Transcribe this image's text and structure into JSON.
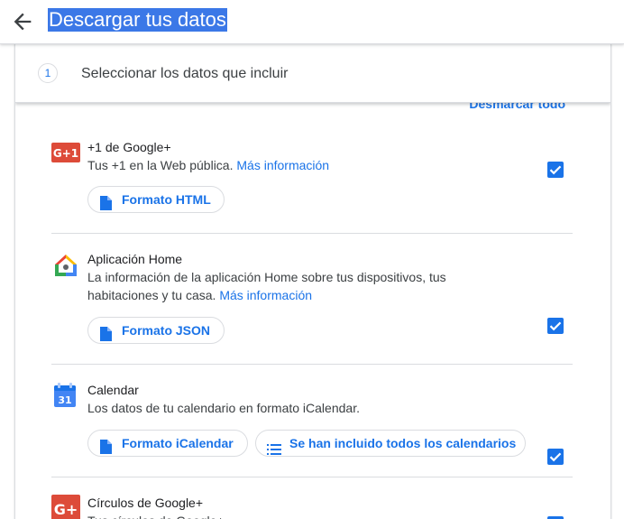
{
  "header": {
    "title": "Descargar tus datos"
  },
  "step": {
    "number": "1",
    "title": "Seleccionar los datos que incluir"
  },
  "deselect_all": "Desmarcar todo",
  "products": [
    {
      "name": "+1 de Google+",
      "description": "Tus +1 en la Web pública.",
      "more": "Más información",
      "checked": true,
      "format_label": "Formato HTML",
      "icon": "google-plus-one-icon"
    },
    {
      "name": "Aplicación Home",
      "description_line1": "La información de la aplicación Home sobre tus dispositivos, tus",
      "description_line2": "habitaciones y tu casa.",
      "more": "Más información",
      "checked": true,
      "format_label": "Formato JSON",
      "icon": "google-home-icon"
    },
    {
      "name": "Calendar",
      "description": "Los datos de tu calendario en formato iCalendar.",
      "checked": true,
      "format_label": "Formato iCalendar",
      "extra_label": "Se han incluido todos los calendarios",
      "icon": "calendar-icon",
      "icon_text": "31"
    },
    {
      "name": "Círculos de Google+",
      "description": "Tus círculos de Google+",
      "checked": true,
      "icon": "google-plus-icon"
    }
  ],
  "colors": {
    "accent": "#1a73e8",
    "selection": "#3b78e7",
    "divider": "#dadce0"
  }
}
